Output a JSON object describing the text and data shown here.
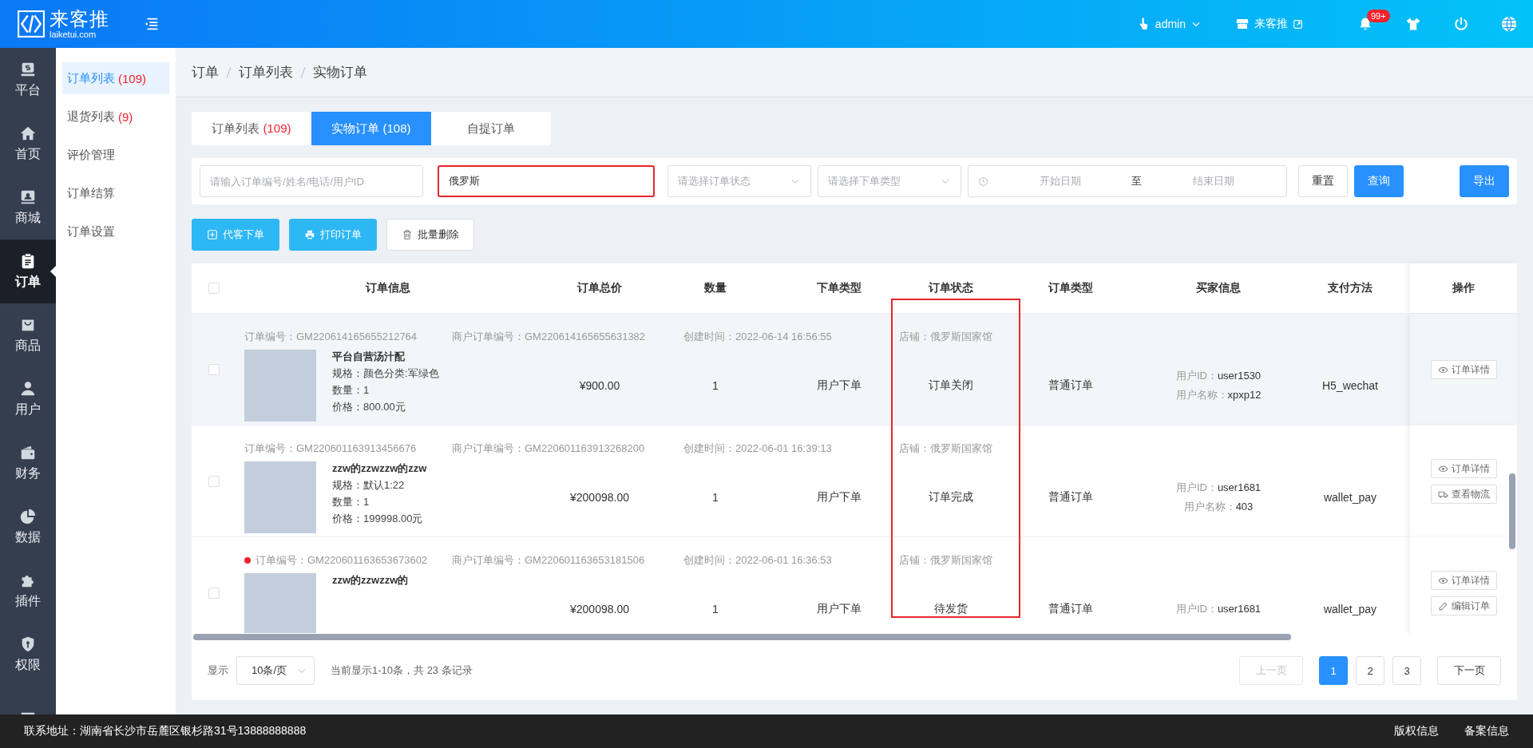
{
  "top_bar": {
    "logo": {
      "name": "来客推",
      "domain": "laiketui.com"
    },
    "user": "admin",
    "store": "来客推",
    "notifications_badge": "99+"
  },
  "nav": {
    "items": [
      {
        "label": "平台",
        "selected": false
      },
      {
        "label": "首页",
        "selected": false
      },
      {
        "label": "商城",
        "selected": false
      },
      {
        "label": "订单",
        "selected": true
      },
      {
        "label": "商品",
        "selected": false
      },
      {
        "label": "用户",
        "selected": false
      },
      {
        "label": "财务",
        "selected": false
      },
      {
        "label": "数据",
        "selected": false
      },
      {
        "label": "插件",
        "selected": false
      },
      {
        "label": "权限",
        "selected": false
      },
      {
        "selected": false
      }
    ]
  },
  "submenu": {
    "items": [
      {
        "label": "订单列表",
        "count": "(109)",
        "selected": true
      },
      {
        "label": "退货列表",
        "count": "(9)",
        "selected": false
      },
      {
        "label": "评价管理",
        "selected": false
      },
      {
        "label": "订单结算",
        "selected": false
      },
      {
        "label": "订单设置",
        "selected": false
      }
    ]
  },
  "breadcrumb": [
    "订单",
    "订单列表",
    "实物订单"
  ],
  "tabs": [
    {
      "label": "订单列表",
      "count": "(109)",
      "selected": false
    },
    {
      "label": "实物订单",
      "count": "(108)",
      "selected": true
    },
    {
      "label": "自提订单",
      "selected": false
    }
  ],
  "filters": {
    "keyword": {
      "placeholder": "请输入订单编号/姓名/电话/用户ID"
    },
    "store": {
      "value": "俄罗斯",
      "highlighted": true
    },
    "status_select": {
      "placeholder": "请选择订单状态"
    },
    "type_select": {
      "placeholder": "请选择下单类型"
    },
    "date_range": {
      "start_placeholder": "开始日期",
      "separator": "至",
      "end_placeholder": "结束日期"
    },
    "buttons": [
      {
        "label": "重置",
        "kind": "default"
      },
      {
        "label": "查询",
        "kind": "primary"
      }
    ],
    "export_button": "导出"
  },
  "actions": [
    {
      "label": "代客下单",
      "kind": "add"
    },
    {
      "label": "打印订单",
      "kind": "print"
    },
    {
      "label": "批量删除",
      "kind": "delete"
    }
  ],
  "table": {
    "header_checked": false,
    "columns": [
      {
        "label": "订单信息",
        "highlighted": false
      },
      {
        "label": "订单总价",
        "highlighted": false
      },
      {
        "label": "数量",
        "highlighted": false
      },
      {
        "label": "下单类型",
        "highlighted": false
      },
      {
        "label": "订单状态",
        "highlighted": true
      },
      {
        "label": "订单类型",
        "highlighted": false
      },
      {
        "label": "买家信息",
        "highlighted": false
      },
      {
        "label": "支付方法",
        "highlighted": false
      },
      {
        "label": "操作",
        "highlighted": false
      }
    ],
    "rows": [
      {
        "hovered": true,
        "unread": false,
        "checked": false,
        "order_no": "订单编号：GM220614165655212764",
        "merchant_no": "商户订单编号：GM220614165655631382",
        "created": "创建时间：2022-06-14 16:56:55",
        "store": "店铺：俄罗斯国家馆",
        "product": {
          "name": "平台自营汤汁配",
          "spec": "规格：颜色分类:军绿色",
          "qty": "数量：1",
          "price": "价格：800.00元"
        },
        "total": "¥900.00",
        "quantity": "1",
        "order_source": "用户下单",
        "status": "订单关闭",
        "order_type": "普通订单",
        "buyer": {
          "id_label": "用户ID：",
          "id": "user1530",
          "name_label": "用户名称：",
          "name": "xpxp12"
        },
        "payment": "H5_wechat",
        "actions": [
          {
            "label": "订单详情",
            "kind": "detail"
          }
        ]
      },
      {
        "hovered": false,
        "unread": false,
        "checked": false,
        "order_no": "订单编号：GM220601163913456676",
        "merchant_no": "商户订单编号：GM220601163913268200",
        "created": "创建时间：2022-06-01 16:39:13",
        "store": "店铺：俄罗斯国家馆",
        "product": {
          "name": "zzw的zzwzzw的zzw",
          "spec": "规格：默认1:22",
          "qty": "数量：1",
          "price": "价格：199998.00元"
        },
        "total": "¥200098.00",
        "quantity": "1",
        "order_source": "用户下单",
        "status": "订单完成",
        "order_type": "普通订单",
        "buyer": {
          "id_label": "用户ID：",
          "id": "user1681",
          "name_label": "用户名称：",
          "name": "403"
        },
        "payment": "wallet_pay",
        "actions": [
          {
            "label": "订单详情",
            "kind": "detail"
          },
          {
            "label": "查看物流",
            "kind": "logistics"
          }
        ]
      },
      {
        "hovered": false,
        "unread": true,
        "checked": false,
        "order_no": "订单编号：GM220601163653673602",
        "merchant_no": "商户订单编号：GM220601163653181506",
        "created": "创建时间：2022-06-01 16:36:53",
        "store": "店铺：俄罗斯国家馆",
        "product": {
          "name": "zzw的zzwzzw的"
        },
        "total": "¥200098.00",
        "quantity": "1",
        "order_source": "用户下单",
        "status": "待发货",
        "order_type": "普通订单",
        "buyer": {
          "id_label": "用户ID：",
          "id": "user1681"
        },
        "payment": "wallet_pay",
        "actions": [
          {
            "label": "订单详情",
            "kind": "detail"
          },
          {
            "label": "编辑订单",
            "kind": "edit"
          }
        ]
      }
    ]
  },
  "pagination": {
    "show_label": "显示",
    "page_size": "10条/页",
    "summary": "当前显示1-10条，共 23 条记录",
    "prev": {
      "label": "上一页",
      "disabled": true
    },
    "pages": [
      {
        "label": "1",
        "selected": true
      },
      {
        "label": "2",
        "selected": false
      },
      {
        "label": "3",
        "selected": false
      }
    ],
    "next": {
      "label": "下一页",
      "disabled": false
    }
  },
  "footer": {
    "address": "联系地址：湖南省长沙市岳麓区银杉路31号13888888888",
    "links": [
      "版权信息",
      "备案信息"
    ]
  }
}
